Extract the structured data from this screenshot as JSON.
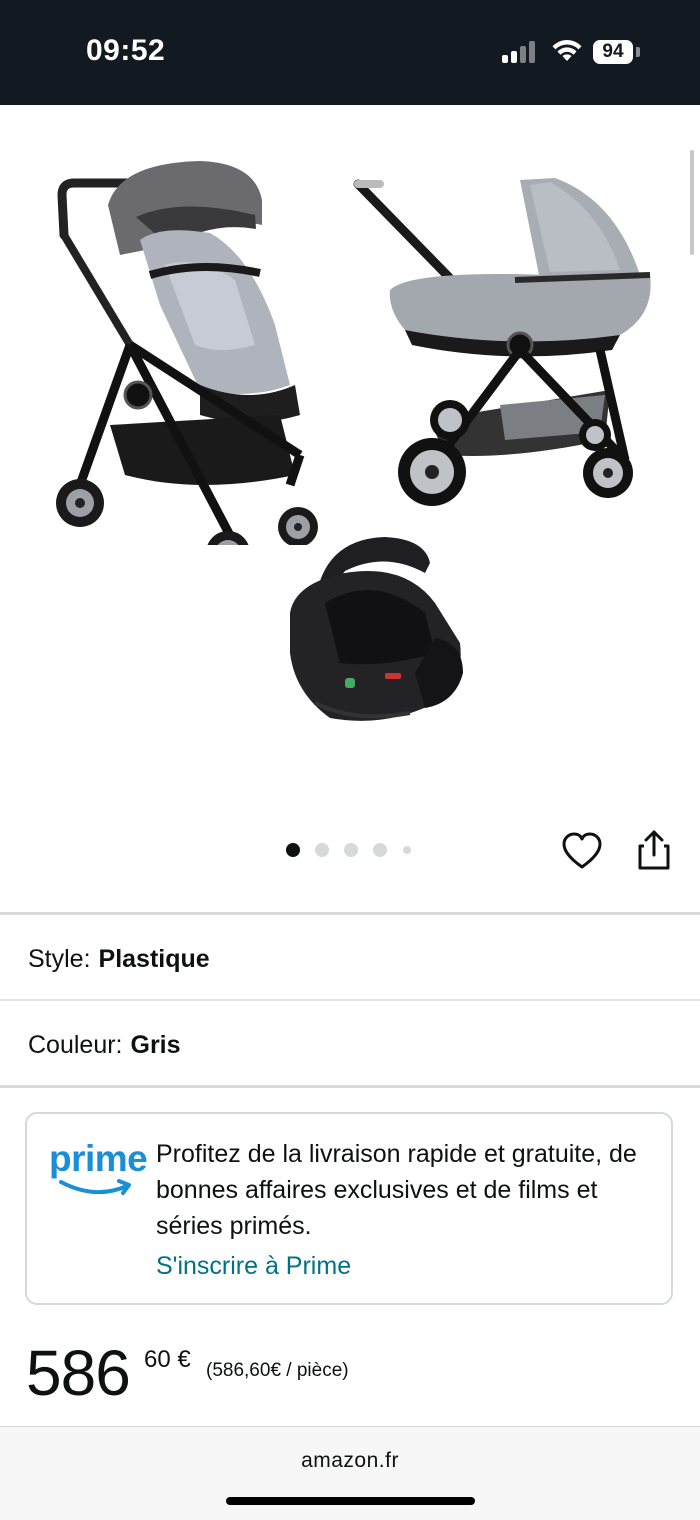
{
  "status_bar": {
    "time": "09:52",
    "battery": "94"
  },
  "gallery": {
    "image_count": 5,
    "active_index": 0,
    "images": [
      "stroller-seat",
      "stroller-carrycot",
      "infant-car-seat"
    ]
  },
  "actions": {
    "favorite_icon": "heart-icon",
    "share_icon": "share-icon"
  },
  "options": {
    "style_label": "Style:",
    "style_value": "Plastique",
    "color_label": "Couleur:",
    "color_value": "Gris"
  },
  "prime": {
    "logo_text": "prime",
    "description": "Profitez de la livraison rapide et gratuite, de bonnes affaires exclusives et de films et séries primés.",
    "link": "S'inscrire à Prime",
    "color": "#1a8fd8",
    "link_color": "#007185"
  },
  "price": {
    "whole": "586",
    "fraction": "60 €",
    "unit_price": "(586,60€ / pièce)"
  },
  "browser": {
    "url": "amazon.fr"
  }
}
